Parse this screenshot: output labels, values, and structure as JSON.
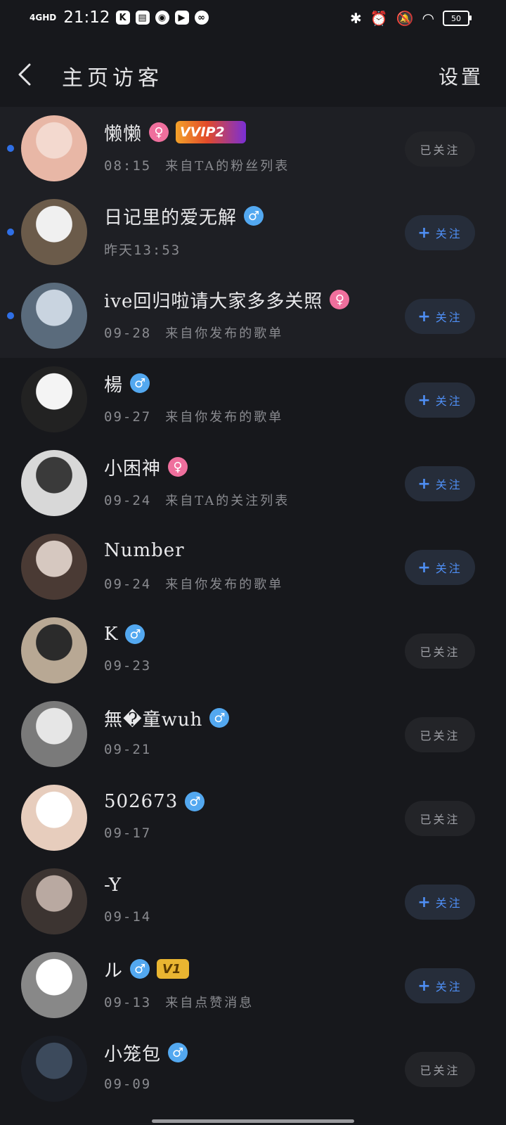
{
  "status_bar": {
    "network": "4GHD",
    "time": "21:12",
    "battery": "50",
    "app_icons": [
      "k-app-icon",
      "book-icon",
      "audio-icon",
      "play-icon",
      "link-icon"
    ],
    "right_icons": [
      "bluetooth-icon",
      "alarm-icon",
      "mute-icon",
      "wifi-icon",
      "battery-icon"
    ]
  },
  "header": {
    "title": "主页访客",
    "settings_label": "设置"
  },
  "labels": {
    "following": "已关注",
    "follow": "关注",
    "plus": "+"
  },
  "visitors": [
    {
      "name": "懒懒",
      "gender": "female",
      "gender_symbol": "♀",
      "vip": "VIP2",
      "time": "08:15",
      "source": "来自TA的粉丝列表",
      "followed": true,
      "unread": true
    },
    {
      "name": "日记里的爱无解",
      "gender": "male",
      "gender_symbol": "♂",
      "vip": "",
      "time": "昨天13:53",
      "source": "",
      "followed": false,
      "unread": true
    },
    {
      "name": "ive回归啦请大家多多关照",
      "gender": "female",
      "gender_symbol": "♀",
      "vip": "",
      "time": "09-28",
      "source": "来自你发布的歌单",
      "followed": false,
      "unread": true
    },
    {
      "name": "楊",
      "gender": "male",
      "gender_symbol": "♂",
      "vip": "",
      "time": "09-27",
      "source": "来自你发布的歌单",
      "followed": false,
      "unread": false
    },
    {
      "name": "小困神",
      "gender": "female",
      "gender_symbol": "♀",
      "vip": "",
      "time": "09-24",
      "source": "来自TA的关注列表",
      "followed": false,
      "unread": false
    },
    {
      "name": "Number",
      "gender": "",
      "gender_symbol": "",
      "vip": "",
      "time": "09-24",
      "source": "来自你发布的歌单",
      "followed": false,
      "unread": false
    },
    {
      "name": "K",
      "gender": "male",
      "gender_symbol": "♂",
      "vip": "",
      "time": "09-23",
      "source": "",
      "followed": true,
      "unread": false
    },
    {
      "name": "無�童wuh",
      "gender": "male",
      "gender_symbol": "♂",
      "vip": "",
      "time": "09-21",
      "source": "",
      "followed": true,
      "unread": false
    },
    {
      "name": "502673",
      "gender": "male",
      "gender_symbol": "♂",
      "vip": "",
      "time": "09-17",
      "source": "",
      "followed": true,
      "unread": false
    },
    {
      "name": "-Y",
      "gender": "",
      "gender_symbol": "",
      "vip": "",
      "time": "09-14",
      "source": "",
      "followed": false,
      "unread": false
    },
    {
      "name": "ル",
      "gender": "male",
      "gender_symbol": "♂",
      "vip": "1",
      "time": "09-13",
      "source": "来自点赞消息",
      "followed": false,
      "unread": false
    },
    {
      "name": "小笼包",
      "gender": "male",
      "gender_symbol": "♂",
      "vip": "",
      "time": "09-09",
      "source": "",
      "followed": true,
      "unread": false
    }
  ],
  "colors": {
    "background": "#17181c",
    "unread_row": "#1e1f24",
    "accent_blue": "#4f8ff5",
    "unread_dot": "#2f6fe6",
    "male": "#53a8f0",
    "female": "#ef6f9d"
  }
}
